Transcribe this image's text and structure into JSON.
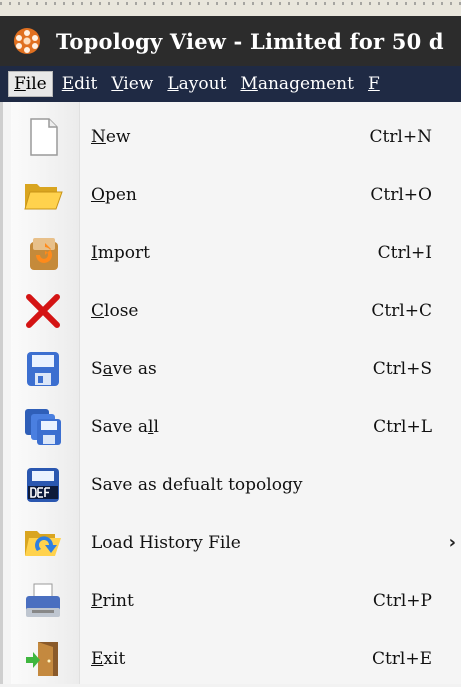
{
  "window": {
    "title": "Topology View - Limited for 50 d"
  },
  "menubar": {
    "items": [
      {
        "key": "F",
        "rest": "ile",
        "active": true
      },
      {
        "key": "E",
        "rest": "dit",
        "active": false
      },
      {
        "key": "V",
        "rest": "iew",
        "active": false
      },
      {
        "key": "L",
        "rest": "ayout",
        "active": false
      },
      {
        "key": "M",
        "rest": "anagement",
        "active": false
      },
      {
        "key": "F",
        "rest": "",
        "active": false
      }
    ]
  },
  "file_menu": {
    "items": [
      {
        "pre": "",
        "key": "N",
        "post": "ew",
        "shortcut": "Ctrl+N",
        "icon": "new-file-icon"
      },
      {
        "pre": "",
        "key": "O",
        "post": "pen",
        "shortcut": "Ctrl+O",
        "icon": "open-folder-icon"
      },
      {
        "pre": "",
        "key": "I",
        "post": "mport",
        "shortcut": "Ctrl+I",
        "icon": "import-icon"
      },
      {
        "pre": "",
        "key": "C",
        "post": "lose",
        "shortcut": "Ctrl+C",
        "icon": "close-icon"
      },
      {
        "pre": "S",
        "key": "a",
        "post": "ve as",
        "shortcut": "Ctrl+S",
        "icon": "save-as-icon"
      },
      {
        "pre": "Save a",
        "key": "l",
        "post": "l",
        "shortcut": "Ctrl+L",
        "icon": "save-all-icon"
      },
      {
        "pre": "Save as defualt topology",
        "key": "",
        "post": "",
        "shortcut": "",
        "icon": "save-default-icon"
      },
      {
        "pre": "Load History File",
        "key": "",
        "post": "",
        "shortcut": "",
        "icon": "load-history-icon",
        "submenu": true
      },
      {
        "pre": "",
        "key": "P",
        "post": "rint",
        "shortcut": "Ctrl+P",
        "icon": "print-icon"
      },
      {
        "pre": "",
        "key": "E",
        "post": "xit",
        "shortcut": "Ctrl+E",
        "icon": "exit-icon"
      }
    ]
  },
  "colors": {
    "titlebar": "#2c2c2c",
    "menubar": "#1f2a44",
    "menu_bg": "#f5f5f5"
  }
}
